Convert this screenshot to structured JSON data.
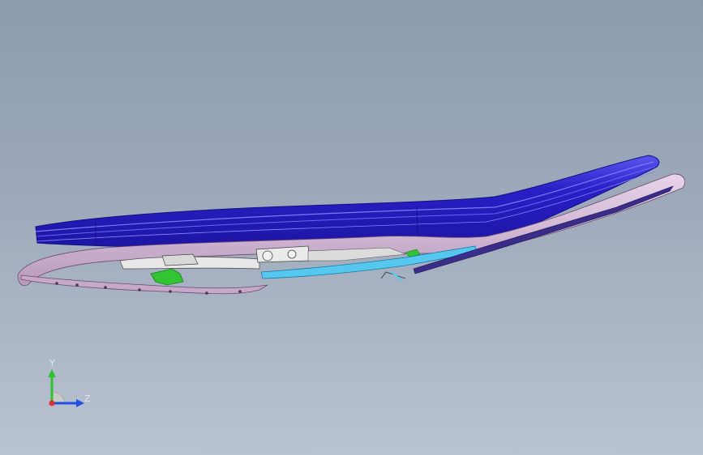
{
  "colors": {
    "background_top": "#8d9aae",
    "background_bottom": "#b9c2d0",
    "cushion": "#2a1fc8",
    "cushion_highlight": "#6a66f0",
    "frame": "#d3b7d6",
    "bracket": "#e6e6e6",
    "green_part": "#33c433",
    "cyan_rail": "#56c8ef",
    "axis_x": "#e03030",
    "axis_y": "#30c030",
    "axis_z": "#2050e0"
  },
  "triad": {
    "y_label": "Y",
    "z_label": "Z"
  }
}
